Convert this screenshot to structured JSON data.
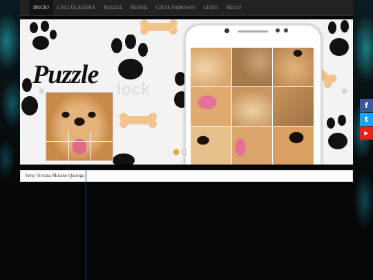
{
  "nav": {
    "items": [
      {
        "label": "INICIO",
        "active": true
      },
      {
        "label": "CALCULADORA",
        "active": false
      },
      {
        "label": "PUZZLE",
        "active": false
      },
      {
        "label": "PERFIL",
        "active": false
      },
      {
        "label": "CITAS FAMOSAS",
        "active": false
      },
      {
        "label": "CITAS",
        "active": false
      },
      {
        "label": "RELOJ",
        "active": false
      }
    ]
  },
  "slider": {
    "title": "Puzzle",
    "prev_icon": "‹",
    "next_icon": "›",
    "accent_color": "#f2b632"
  },
  "caption": {
    "text": "Yeny Viviana Molano Quiroga"
  },
  "social": {
    "facebook_icon": "f",
    "twitter_icon": "t",
    "youtube_icon": "▶"
  }
}
